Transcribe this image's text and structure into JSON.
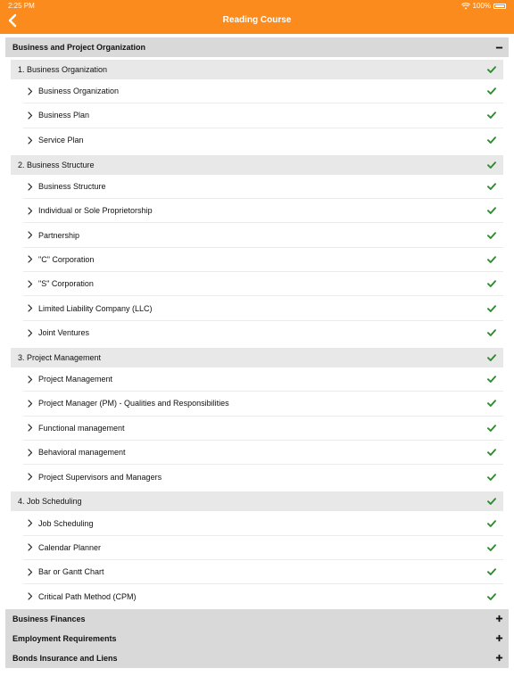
{
  "status_bar": {
    "time": "2:25 PM",
    "battery": "100%"
  },
  "nav": {
    "title": "Reading Course",
    "back_icon": "chevron-left-icon"
  },
  "colors": {
    "header": "#fb8b1d",
    "check": "#2e8b2e"
  },
  "expanded_section": {
    "title": "Business and Project Organization",
    "subsections": [
      {
        "title": "1. Business Organization",
        "lessons": [
          "Business Organization",
          "Business Plan",
          "Service Plan"
        ]
      },
      {
        "title": "2. Business Structure",
        "lessons": [
          "Business Structure",
          "Individual or Sole Proprietorship",
          "Partnership",
          "\"C\" Corporation",
          "\"S\" Corporation",
          "Limited Liability Company (LLC)",
          "Joint Ventures"
        ]
      },
      {
        "title": "3. Project Management",
        "lessons": [
          "Project Management",
          "Project Manager (PM) - Qualities and Responsibilities",
          "Functional management",
          "Behavioral management",
          "Project Supervisors and Managers"
        ]
      },
      {
        "title": "4. Job Scheduling",
        "lessons": [
          "Job Scheduling",
          "Calendar Planner",
          "Bar or Gantt Chart",
          "Critical Path Method (CPM)"
        ]
      }
    ]
  },
  "collapsed_sections": [
    "Business Finances",
    "Employment Requirements",
    "Bonds Insurance and Liens"
  ]
}
